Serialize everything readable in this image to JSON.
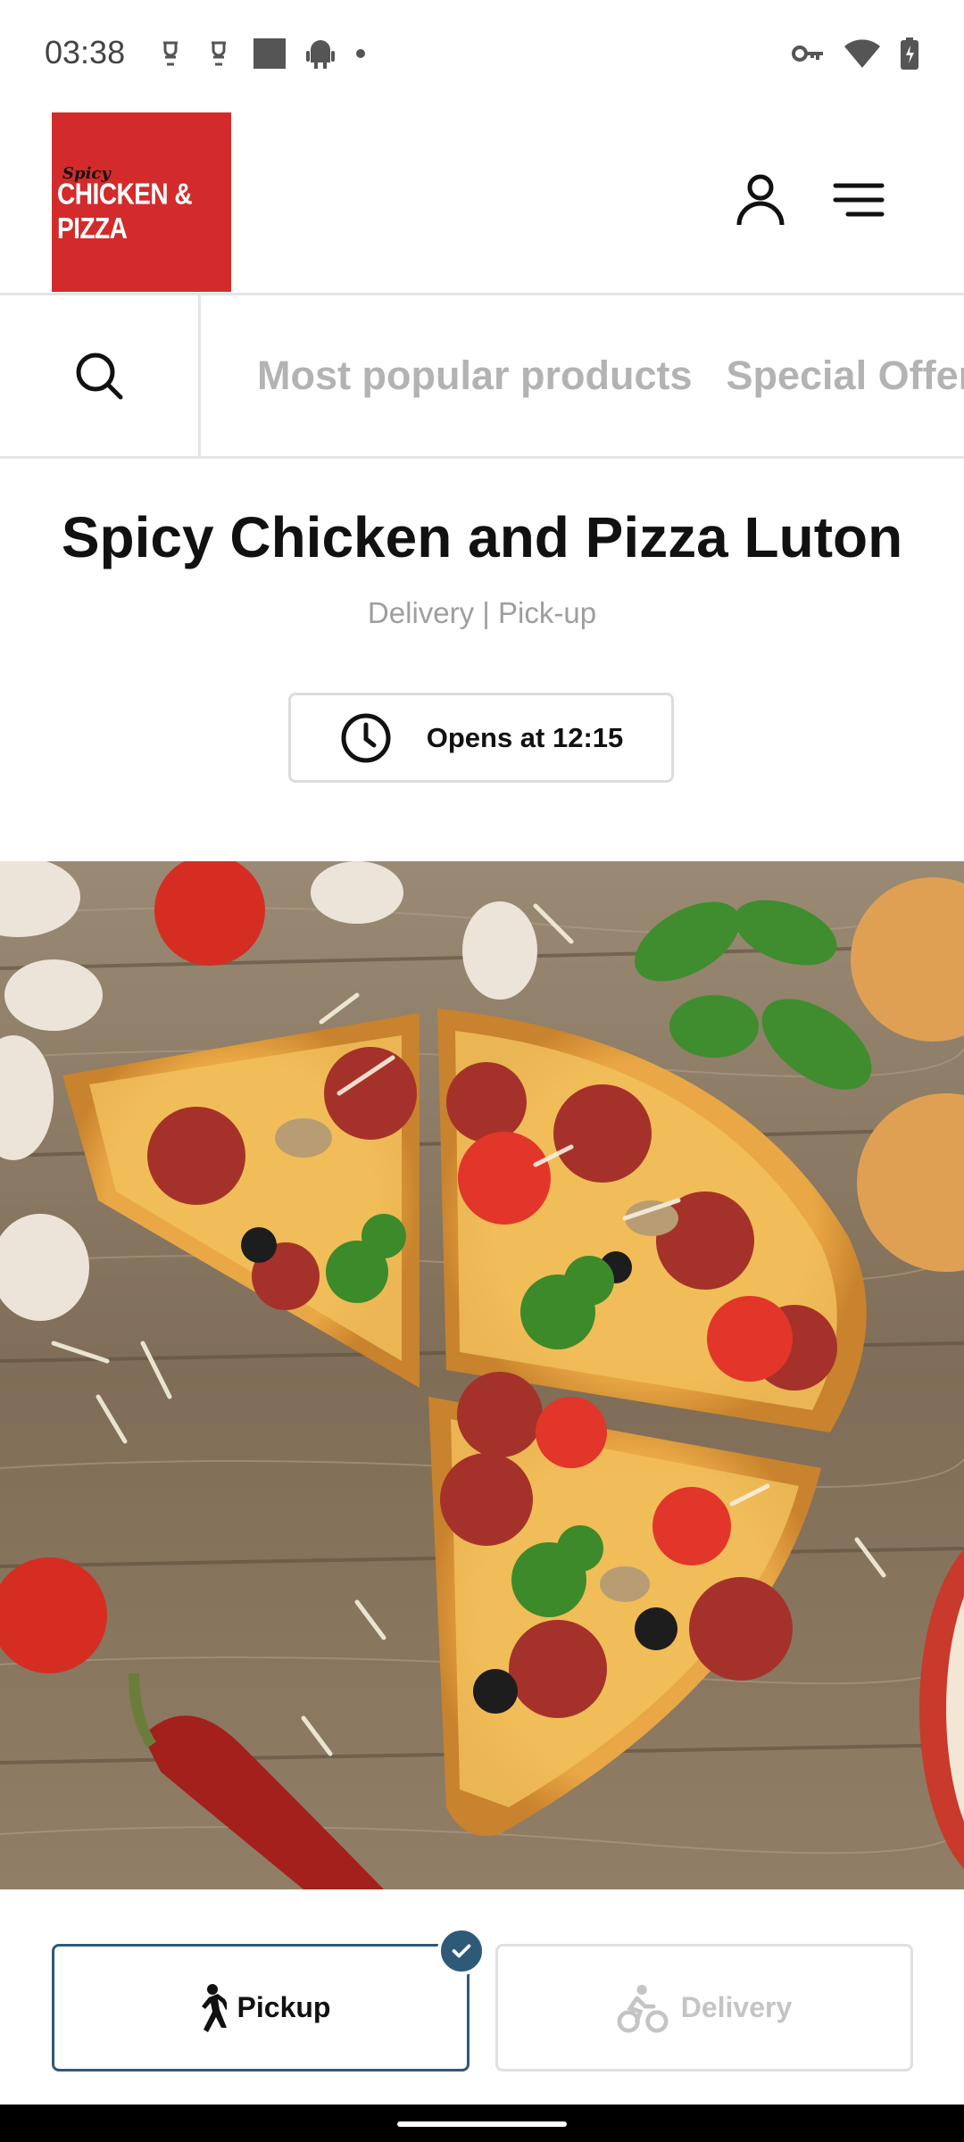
{
  "status_bar": {
    "time": "03:38",
    "left_icons": [
      "notification-icon",
      "notification-icon",
      "image-icon",
      "android-icon",
      "dot-icon"
    ],
    "right_icons": [
      "key-icon",
      "wifi-icon",
      "battery-charging-icon"
    ]
  },
  "header": {
    "logo": {
      "small_text": "Spicy",
      "big_text": "CHICKEN & PIZZA",
      "bg_color": "#d32b2b"
    },
    "account_icon": "user-icon",
    "menu_icon": "hamburger-menu-icon"
  },
  "categories": {
    "search_icon": "search-icon",
    "tabs": [
      {
        "label": "Most popular products"
      },
      {
        "label": "Special Offers"
      }
    ]
  },
  "restaurant": {
    "name": "Spicy Chicken and Pizza Luton",
    "services": "Delivery | Pick-up",
    "opening": "Opens at 12:15",
    "hero_image": "pizza-on-wooden-table"
  },
  "order_mode": {
    "pickup_label": "Pickup",
    "delivery_label": "Delivery",
    "selected": "pickup",
    "accent_color": "#2e5a78"
  }
}
